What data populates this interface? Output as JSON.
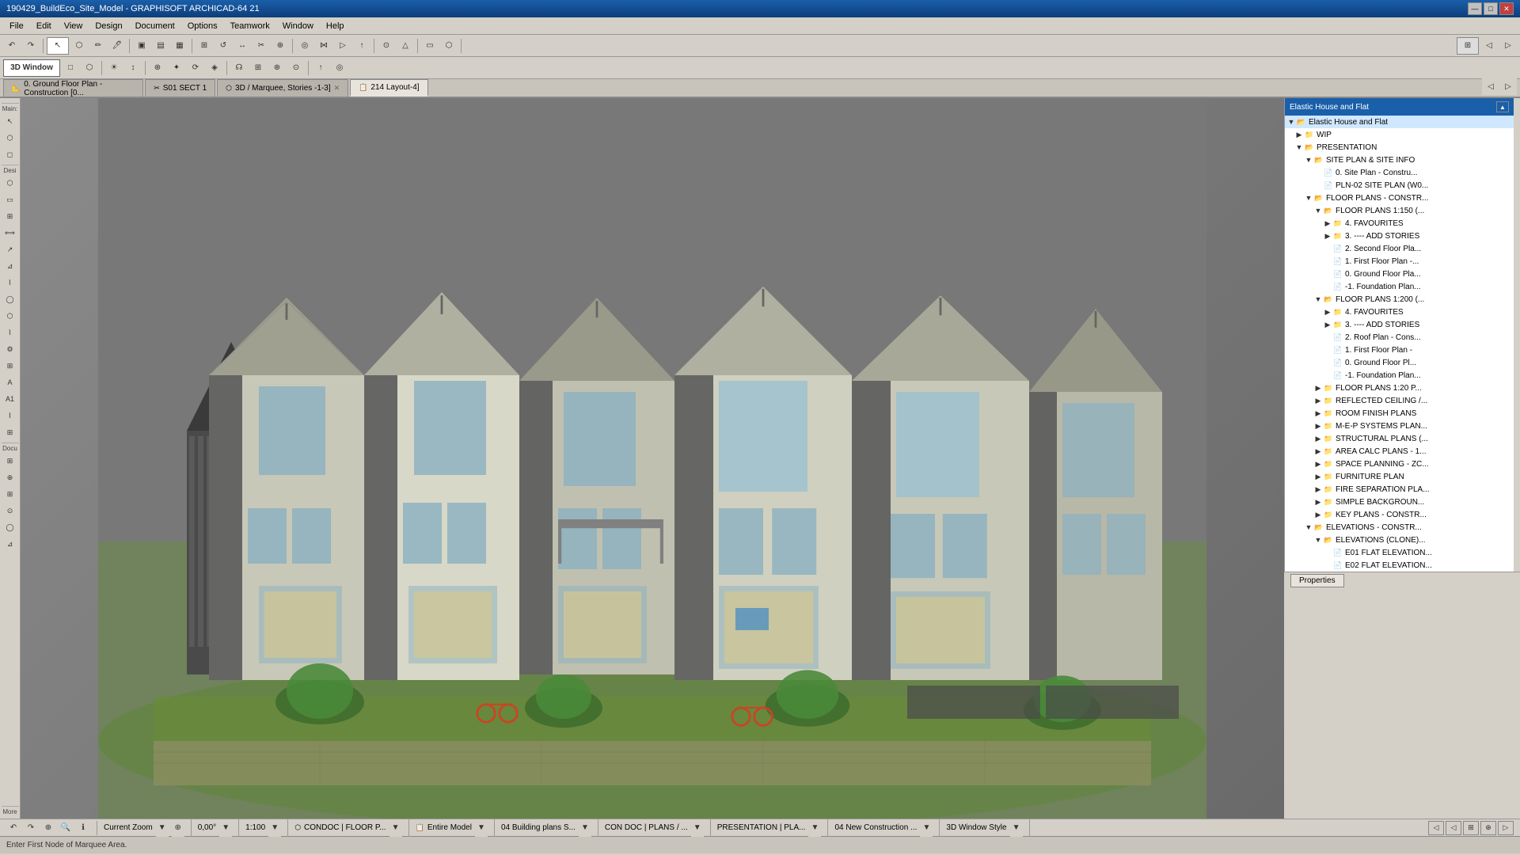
{
  "app": {
    "title": "190429_BuildEco_Site_Model - GRAPHISOFT ARCHICAD-64 21",
    "window_controls": [
      "—",
      "□",
      "✕"
    ]
  },
  "menu": {
    "items": [
      "File",
      "Edit",
      "View",
      "Design",
      "Document",
      "Options",
      "Teamwork",
      "Window",
      "Help"
    ]
  },
  "toolbar1": {
    "buttons": [
      "↶",
      "↷",
      "⊕",
      "✏",
      "🖊",
      "▣",
      "▤",
      "▦",
      "◈",
      "⊞",
      "⟵",
      "⟶",
      "↕",
      "✂",
      "⊕",
      "↺",
      "◎",
      "⋈",
      "▷",
      "↑",
      "⊙",
      "△"
    ]
  },
  "toolbar2": {
    "buttons": [
      "3D Window",
      "□",
      "⬡",
      "☀",
      "↕",
      "⊕",
      "✦",
      "⟳",
      "◈",
      "☊",
      "⊞",
      "⊕",
      "⊙",
      "↑",
      "◎",
      "⊕",
      "⊙",
      "⊗",
      "⊕",
      "⊕",
      "⊙",
      "⊕"
    ]
  },
  "tabs": [
    {
      "label": "0. Ground Floor Plan - Construction [0...",
      "active": false,
      "closeable": false
    },
    {
      "label": "S01 SECT 1",
      "active": false,
      "closeable": false
    },
    {
      "label": "3D / Marquee, Stories -1-3]",
      "active": false,
      "closeable": true
    },
    {
      "label": "214 Layout-4]",
      "active": true,
      "closeable": false
    }
  ],
  "left_tools": {
    "sections": [
      {
        "label": "Main:",
        "tools": [
          "↖",
          "⬡",
          "◻"
        ]
      },
      {
        "label": "Desi",
        "tools": [
          "⬡",
          "▭",
          "⊞",
          "⟺",
          "↗",
          "⊿",
          "⌇",
          "◯",
          "⬡",
          "⌇",
          "⚙",
          "⊞",
          "A",
          "A1",
          "⌇",
          "⊞"
        ]
      },
      {
        "label": "Docu",
        "tools": [
          "⊞",
          "⊕",
          "⊞",
          "⊙",
          "◯",
          "⊿"
        ]
      }
    ]
  },
  "viewport": {
    "background_color": "#6a6a6a",
    "info_label": ""
  },
  "right_panel": {
    "title": "Elastic House and Flat",
    "tree": [
      {
        "id": 1,
        "level": 0,
        "type": "folder",
        "expanded": false,
        "label": "Elastic House and Flat"
      },
      {
        "id": 2,
        "level": 1,
        "type": "folder",
        "expanded": false,
        "label": "WIP"
      },
      {
        "id": 3,
        "level": 1,
        "type": "folder",
        "expanded": true,
        "label": "PRESENTATION"
      },
      {
        "id": 4,
        "level": 2,
        "type": "folder",
        "expanded": true,
        "label": "SITE PLAN & SITE INFO"
      },
      {
        "id": 5,
        "level": 3,
        "type": "file",
        "label": "0. Site Plan - Constru..."
      },
      {
        "id": 6,
        "level": 3,
        "type": "file",
        "label": "PLN-02 SITE PLAN (W0..."
      },
      {
        "id": 7,
        "level": 2,
        "type": "folder",
        "expanded": true,
        "label": "FLOOR PLANS - CONSTR..."
      },
      {
        "id": 8,
        "level": 3,
        "type": "folder",
        "expanded": true,
        "label": "FLOOR PLANS 1:150 (..."
      },
      {
        "id": 9,
        "level": 4,
        "type": "folder",
        "expanded": false,
        "label": "4. FAVOURITES"
      },
      {
        "id": 10,
        "level": 4,
        "type": "folder",
        "expanded": false,
        "label": "3. ---- ADD STORIES"
      },
      {
        "id": 11,
        "level": 4,
        "type": "file",
        "label": "2. Second Floor Pla..."
      },
      {
        "id": 12,
        "level": 4,
        "type": "file",
        "label": "1. First Floor Plan -..."
      },
      {
        "id": 13,
        "level": 4,
        "type": "file",
        "label": "0. Ground Floor Pla..."
      },
      {
        "id": 14,
        "level": 4,
        "type": "file",
        "label": "-1. Foundation Plan..."
      },
      {
        "id": 15,
        "level": 3,
        "type": "folder",
        "expanded": true,
        "label": "FLOOR PLANS 1:200 (..."
      },
      {
        "id": 16,
        "level": 4,
        "type": "folder",
        "expanded": false,
        "label": "4. FAVOURITES"
      },
      {
        "id": 17,
        "level": 4,
        "type": "folder",
        "expanded": false,
        "label": "3. ---- ADD STORIES"
      },
      {
        "id": 18,
        "level": 4,
        "type": "file",
        "label": "2. Roof Plan - Cons..."
      },
      {
        "id": 19,
        "level": 4,
        "type": "file",
        "label": "1. First Floor Plan -"
      },
      {
        "id": 20,
        "level": 4,
        "type": "file",
        "label": "0. Ground Floor Pl..."
      },
      {
        "id": 21,
        "level": 4,
        "type": "file",
        "label": "-1. Foundation Plan..."
      },
      {
        "id": 22,
        "level": 3,
        "type": "folder",
        "expanded": false,
        "label": "FLOOR PLANS 1:20 P..."
      },
      {
        "id": 23,
        "level": 3,
        "type": "folder",
        "expanded": false,
        "label": "REFLECTED CEILING /..."
      },
      {
        "id": 24,
        "level": 3,
        "type": "folder",
        "expanded": false,
        "label": "ROOM FINISH PLANS"
      },
      {
        "id": 25,
        "level": 3,
        "type": "folder",
        "expanded": false,
        "label": "M-E-P SYSTEMS PLAN..."
      },
      {
        "id": 26,
        "level": 3,
        "type": "folder",
        "expanded": false,
        "label": "STRUCTURAL PLANS (..."
      },
      {
        "id": 27,
        "level": 3,
        "type": "folder",
        "expanded": false,
        "label": "AREA CALC PLANS - 1..."
      },
      {
        "id": 28,
        "level": 3,
        "type": "folder",
        "expanded": false,
        "label": "SPACE PLANNING - ZC..."
      },
      {
        "id": 29,
        "level": 3,
        "type": "folder",
        "expanded": false,
        "label": "FURNITURE PLAN"
      },
      {
        "id": 30,
        "level": 3,
        "type": "folder",
        "expanded": false,
        "label": "FIRE SEPARATION PLA..."
      },
      {
        "id": 31,
        "level": 3,
        "type": "folder",
        "expanded": false,
        "label": "SIMPLE BACKGROUN..."
      },
      {
        "id": 32,
        "level": 3,
        "type": "folder",
        "expanded": false,
        "label": "KEY PLANS - CONSTR..."
      },
      {
        "id": 33,
        "level": 2,
        "type": "folder",
        "expanded": true,
        "label": "ELEVATIONS - CONSTR..."
      },
      {
        "id": 34,
        "level": 3,
        "type": "folder",
        "expanded": true,
        "label": "ELEVATIONS (CLONE)..."
      },
      {
        "id": 35,
        "level": 4,
        "type": "file",
        "label": "E01 FLAT ELEVATION..."
      },
      {
        "id": 36,
        "level": 4,
        "type": "file",
        "label": "E02 FLAT ELEVATION..."
      }
    ]
  },
  "statusbar": {
    "zoom_label": "Current Zoom",
    "angle": "0,00°",
    "scale": "1:100",
    "layer": "CONDOC | FLOOR P...",
    "stories": "Entire Model",
    "building_plans": "04 Building plans S...",
    "con_doc": "CON DOC | PLANS / ...",
    "presentation": "PRESENTATION | PLA...",
    "new_construction": "04 New Construction ...",
    "window_style": "3D Window Style"
  },
  "bottombar": {
    "message": "Enter First Node of Marquee Area.",
    "properties_label": "Properties"
  },
  "icons": {
    "expand": "▶",
    "collapse": "▼",
    "folder": "📁",
    "folder_open": "📂",
    "file_icon": "📄",
    "close": "✕",
    "minimize": "—",
    "maximize": "□"
  }
}
